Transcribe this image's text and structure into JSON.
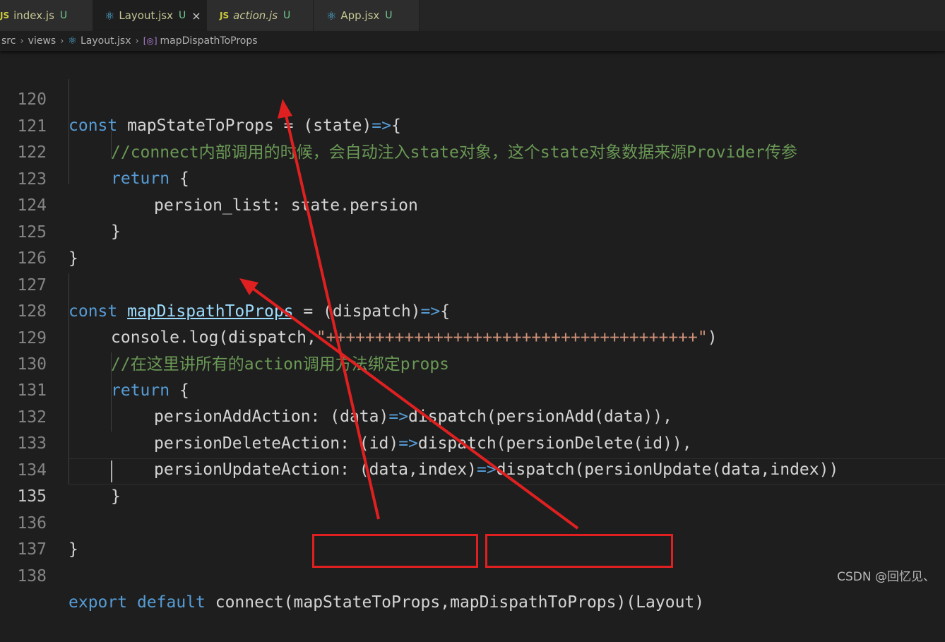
{
  "tabs": [
    {
      "icon": "JS",
      "name": "index.js",
      "status": "U",
      "active": false
    },
    {
      "icon": "react",
      "name": "Layout.jsx",
      "status": "U",
      "active": true,
      "close": "×"
    },
    {
      "icon": "JS",
      "name": "action.js",
      "status": "U",
      "active": false
    },
    {
      "icon": "react",
      "name": "App.jsx",
      "status": "U",
      "active": false
    }
  ],
  "breadcrumb": {
    "src": "src",
    "views": "views",
    "file": "Layout.jsx",
    "symbol": "mapDispathToProps"
  },
  "lines": [
    {
      "n": "120",
      "code": "const mapStateToProps = (state)=>{"
    },
    {
      "n": "121",
      "code": "    //connect内部调用的时候，会自动注入state对象，这个state对象数据来源Provider传参"
    },
    {
      "n": "122",
      "code": "    return {"
    },
    {
      "n": "123",
      "code": "        persion_list: state.persion"
    },
    {
      "n": "124",
      "code": "    }"
    },
    {
      "n": "125",
      "code": "}"
    },
    {
      "n": "126",
      "code": ""
    },
    {
      "n": "127",
      "code": "const mapDispathToProps = (dispatch)=>{"
    },
    {
      "n": "128",
      "code": "    console.log(dispatch,\"++++++++++++++++++++++++++++++++++++++\")"
    },
    {
      "n": "129",
      "code": "    //在这里讲所有的action调用方法绑定props"
    },
    {
      "n": "130",
      "code": "    return {"
    },
    {
      "n": "131",
      "code": "        persionAddAction: (data)=>dispatch(persionAdd(data)),"
    },
    {
      "n": "132",
      "code": "        persionDeleteAction: (id)=>dispatch(persionDelete(id)),"
    },
    {
      "n": "133",
      "code": "        persionUpdateAction: (data,index)=>dispatch(persionUpdate(data,index))"
    },
    {
      "n": "134",
      "code": "    }"
    },
    {
      "n": "135",
      "code": "    "
    },
    {
      "n": "136",
      "code": "}"
    },
    {
      "n": "137",
      "code": ""
    },
    {
      "n": "138",
      "code": "export default connect(mapStateToProps,mapDispathToProps)(Layout)"
    }
  ],
  "tokens": {
    "l120": [
      "const",
      " mapStateToProps ",
      "= ",
      "(state)",
      "=>",
      "{"
    ],
    "l121": [
      "//connect内部调用的时候，会自动注入state对象，这个state对象数据来源Provider传参"
    ],
    "l122": [
      "return",
      " {"
    ],
    "l123": [
      "persion_list: state.persion"
    ],
    "l124": [
      "}"
    ],
    "l125": [
      "}"
    ],
    "l127": [
      "const",
      " ",
      "mapDispathToProps",
      " = (dispatch)",
      "=>",
      "{"
    ],
    "l128": [
      "console.log(dispatch,",
      "\"++++++++++++++++++++++++++++++++++++++\"",
      ")"
    ],
    "l129": [
      "//在这里讲所有的action调用方法绑定props"
    ],
    "l130": [
      "return",
      " {"
    ],
    "l131": [
      "persionAddAction: (data)",
      "=>",
      "dispatch(persionAdd(data)),"
    ],
    "l132": [
      "persionDeleteAction: (id)",
      "=>",
      "dispatch(persionDelete(id)),"
    ],
    "l133": [
      "persionUpdateAction: (data,index)",
      "=>",
      "dispatch(persionUpdate(data,index))"
    ],
    "l134": [
      "}"
    ],
    "l136": [
      "}"
    ],
    "l138": [
      "export",
      " ",
      "default",
      " connect(",
      "mapStateToProps",
      ",",
      "mapDispathToProps",
      ")(Layout)"
    ]
  },
  "colors": {
    "keyword": "#569cd6",
    "comment": "#6a9955",
    "string": "#ce9178",
    "annotation": "#e02020",
    "background": "#1e1e1e"
  },
  "watermark": "CSDN @回忆见、"
}
